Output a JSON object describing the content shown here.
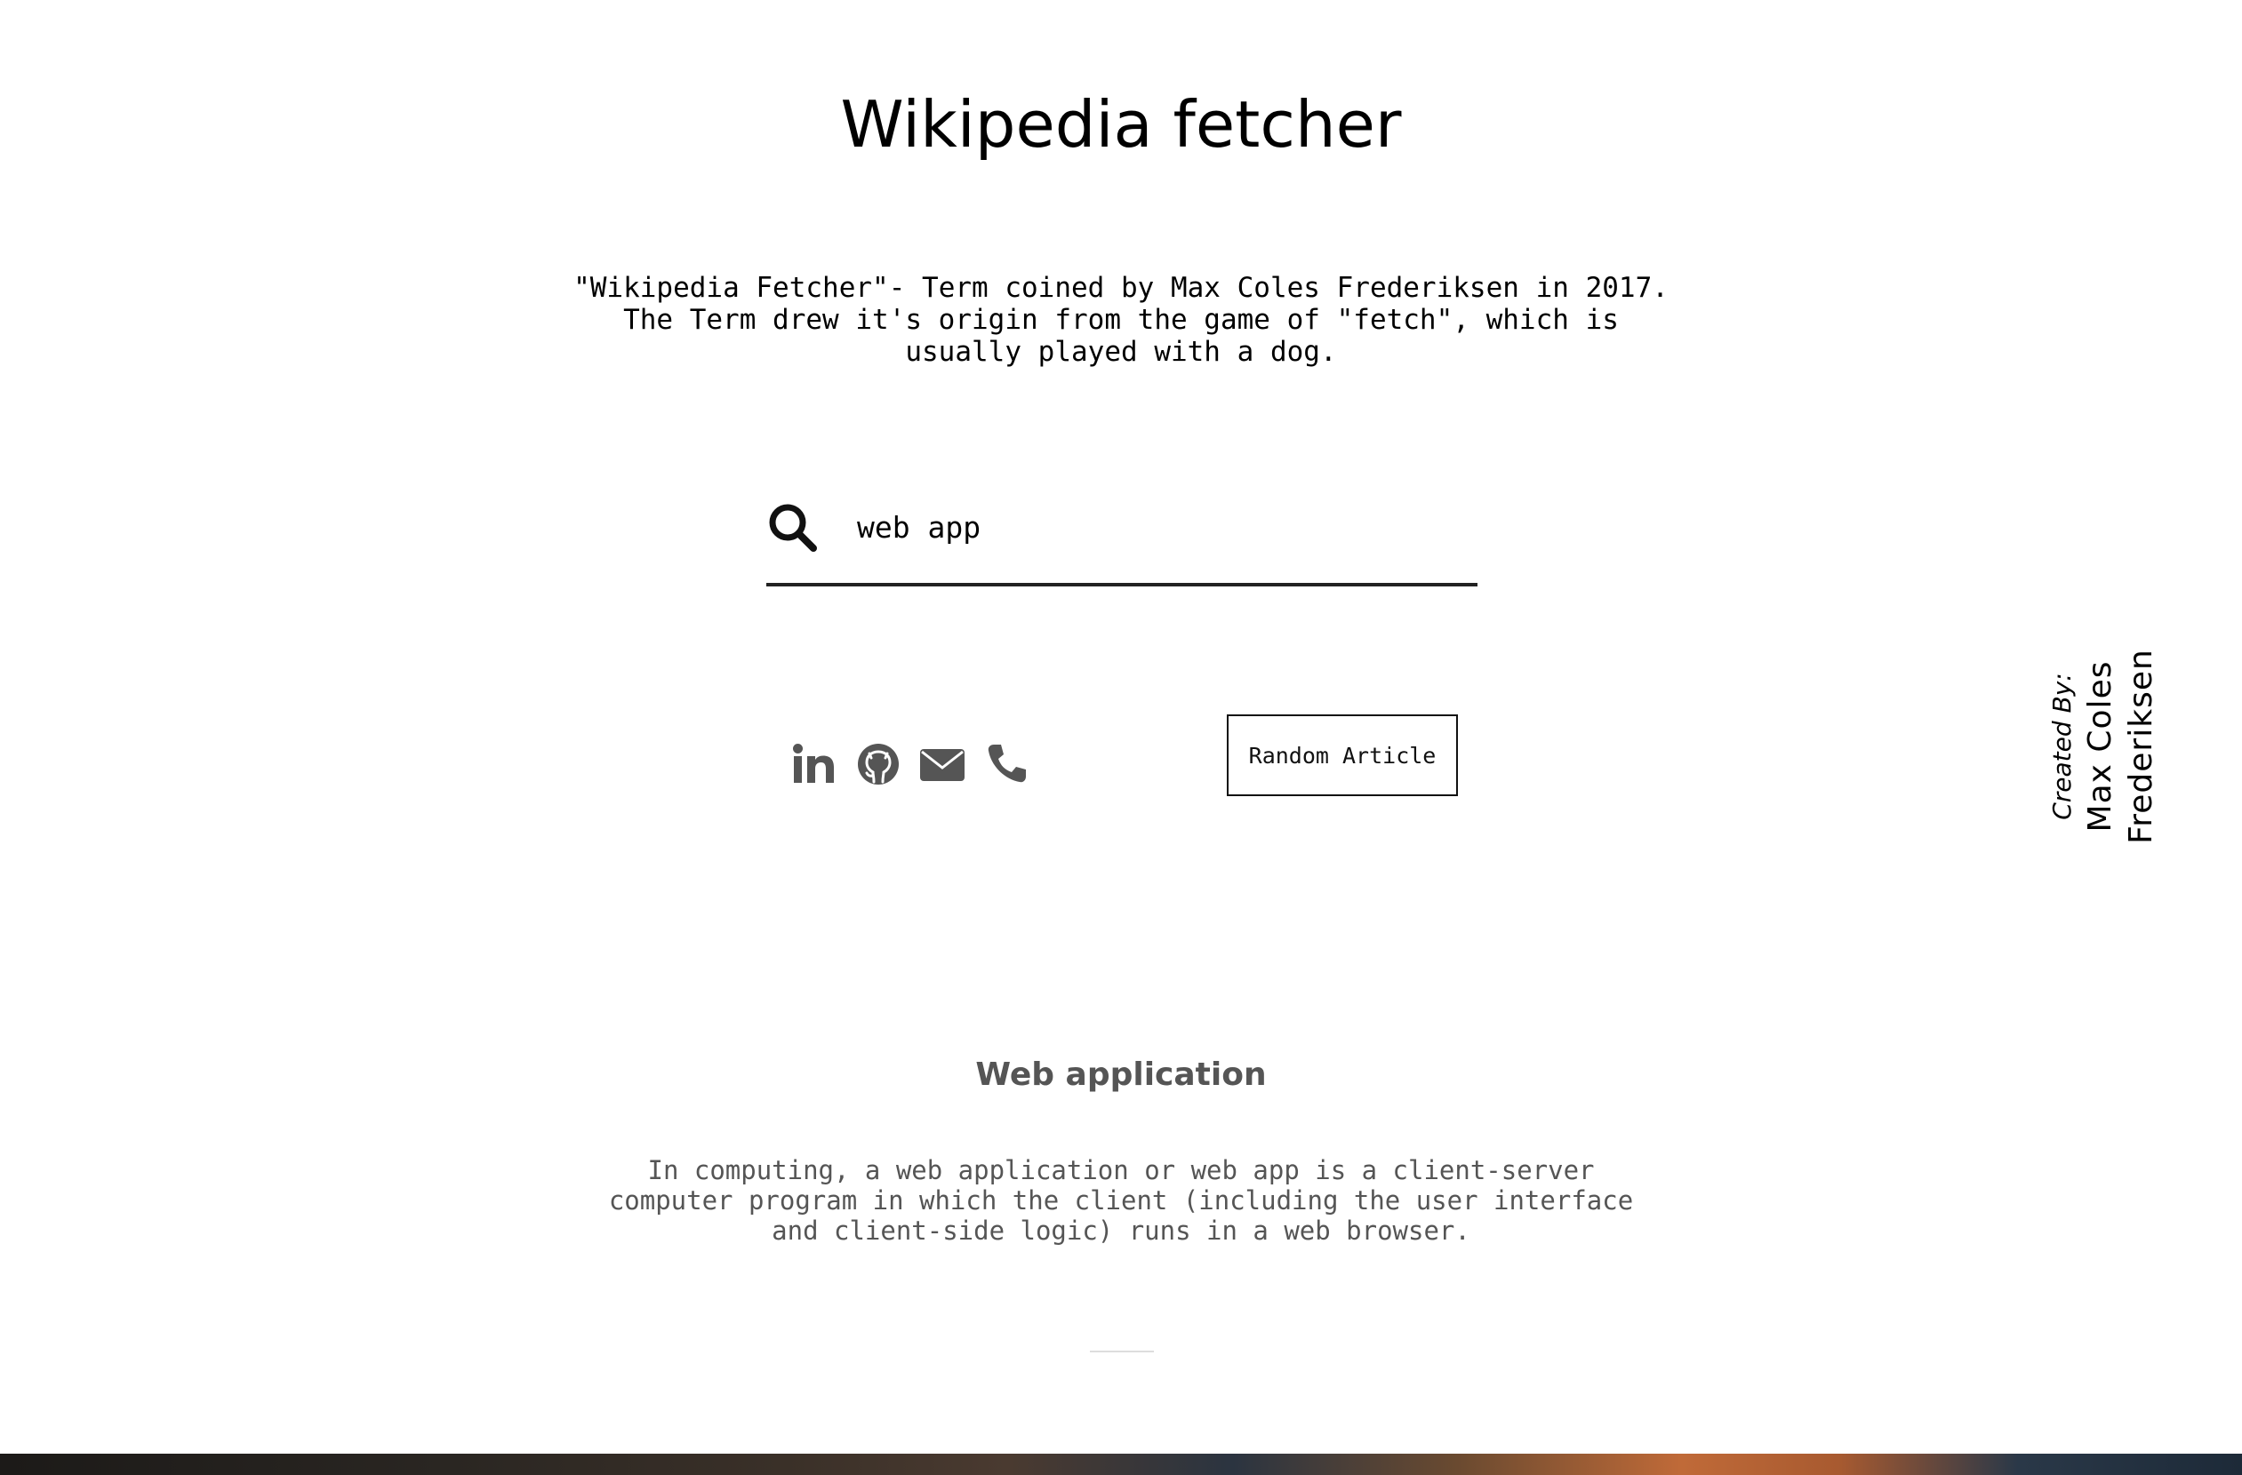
{
  "header": {
    "title": "Wikipedia fetcher"
  },
  "intro": {
    "text": "\"Wikipedia Fetcher\"- Term coined by Max Coles Frederiksen in 2017. The Term drew it's origin from the game of \"fetch\", which is usually played with a dog."
  },
  "search": {
    "value": "web app",
    "icon": "search-icon"
  },
  "social": {
    "icons": [
      "linkedin-icon",
      "github-icon",
      "mail-icon",
      "phone-icon"
    ],
    "color": "#555555"
  },
  "random_button": {
    "label": "Random Article"
  },
  "result": {
    "title": "Web application",
    "text": "In computing, a web application or web app is a client-server computer program in which the client (including the user interface and client-side logic) runs in a web browser."
  },
  "credit": {
    "label": "Created By:",
    "name": "Max Coles Frederiksen"
  }
}
